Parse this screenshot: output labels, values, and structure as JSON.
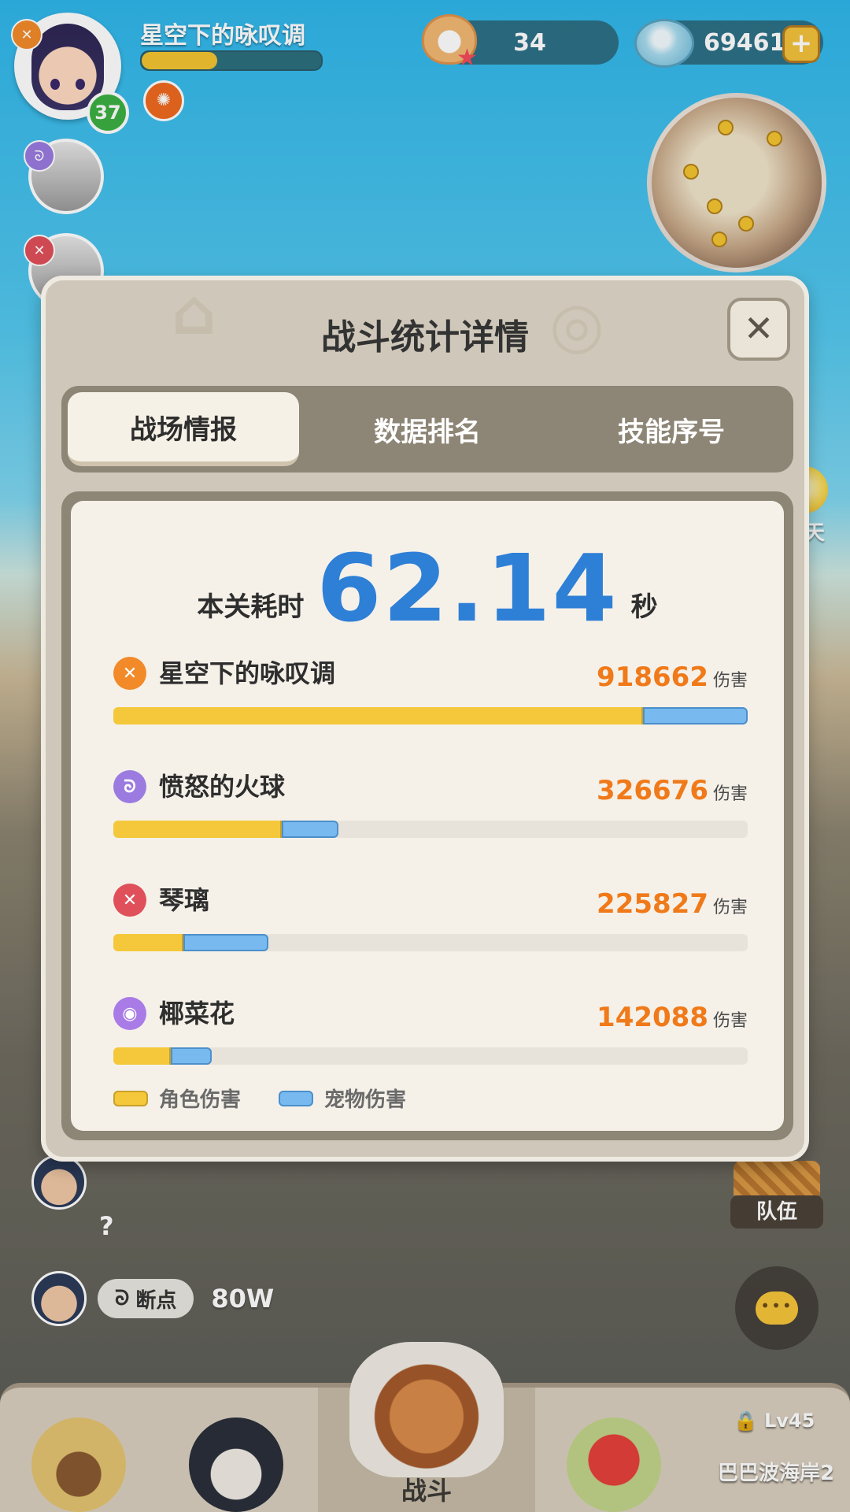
{
  "player": {
    "name": "星空下的咏叹调",
    "level": "37",
    "xp_fraction": 0.42
  },
  "currency": {
    "pearls": "34",
    "shells": "69461"
  },
  "chat": {
    "line1_tail": "?",
    "line2_tag": "断点",
    "line2_text": "80W"
  },
  "side": {
    "chat_label": "聊天",
    "team_label": "队伍"
  },
  "bottom_nav": {
    "battle_label": "战斗",
    "lock_level": "Lv45",
    "region_label": "巴巴波海岸2"
  },
  "modal": {
    "title": "战斗统计详情",
    "close_icon": "close-icon",
    "tabs": [
      {
        "label": "战场情报",
        "active": true
      },
      {
        "label": "数据排名",
        "active": false
      },
      {
        "label": "技能序号",
        "active": false
      }
    ],
    "time_label": "本关耗时",
    "time_value": "62.14",
    "time_unit": "秒",
    "damage_unit": "伤害",
    "legend": {
      "role_label": "角色伤害",
      "pet_label": "宠物伤害",
      "role_color": "#f4c83a",
      "pet_color": "#78b9ef"
    },
    "rows": [
      {
        "name": "星空下的咏叹调",
        "damage": "918662",
        "icon": "wing-class-icon",
        "icon_color": "#f28a2a",
        "role_fraction": 0.835,
        "pet_fraction": 0.165
      },
      {
        "name": "愤怒的火球",
        "damage": "326676",
        "icon": "swirl-class-icon",
        "icon_color": "#9b7be0",
        "role_fraction": 0.265,
        "pet_fraction": 0.09
      },
      {
        "name": "琴璃",
        "damage": "225827",
        "icon": "claw-class-icon",
        "icon_color": "#e0505a",
        "role_fraction": 0.11,
        "pet_fraction": 0.135
      },
      {
        "name": "椰菜花",
        "damage": "142088",
        "icon": "orb-class-icon",
        "icon_color": "#a97be6",
        "role_fraction": 0.09,
        "pet_fraction": 0.065
      }
    ]
  }
}
